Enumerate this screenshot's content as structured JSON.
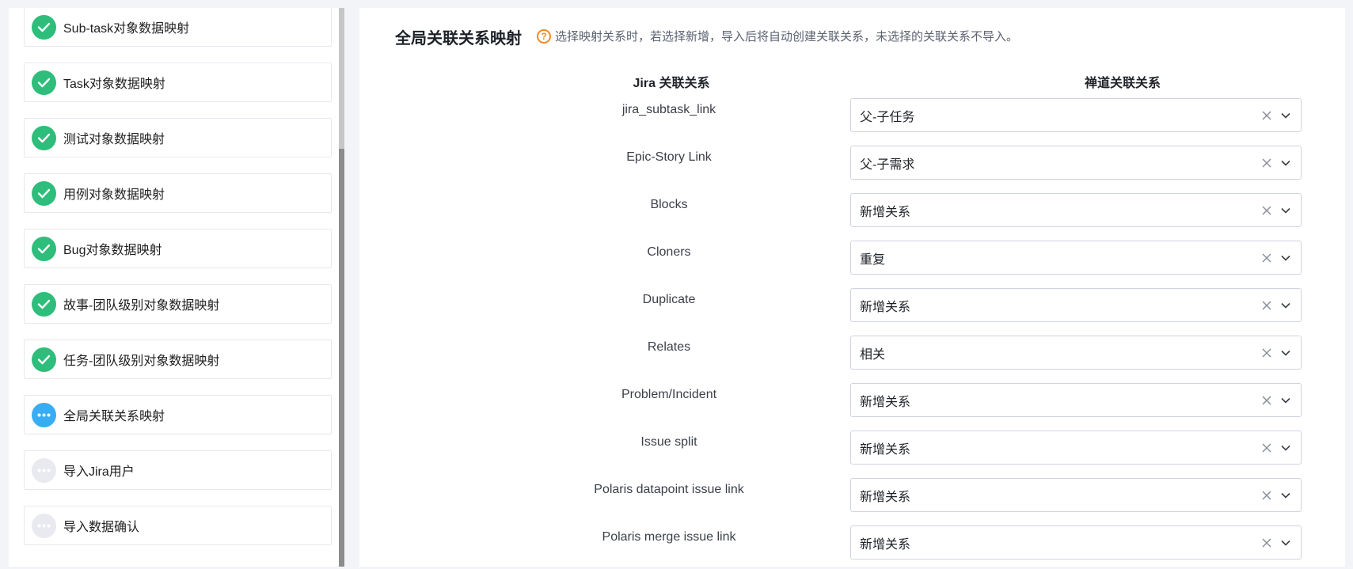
{
  "steps": [
    {
      "label": "Sub-task对象数据映射",
      "status": "done"
    },
    {
      "label": "Task对象数据映射",
      "status": "done"
    },
    {
      "label": "测试对象数据映射",
      "status": "done"
    },
    {
      "label": "用例对象数据映射",
      "status": "done"
    },
    {
      "label": "Bug对象数据映射",
      "status": "done"
    },
    {
      "label": "故事-团队级别对象数据映射",
      "status": "done"
    },
    {
      "label": "任务-团队级别对象数据映射",
      "status": "done"
    },
    {
      "label": "全局关联关系映射",
      "status": "active"
    },
    {
      "label": "导入Jira用户",
      "status": "pending"
    },
    {
      "label": "导入数据确认",
      "status": "pending"
    }
  ],
  "main": {
    "title": "全局关联关系映射",
    "hint_icon": "question-circle-icon",
    "hint": "选择映射关系时，若选择新增，导入后将自动创建关联关系，未选择的关联关系不导入。",
    "col_jira": "Jira 关联关系",
    "col_zentao": "禅道关联关系",
    "rows": [
      {
        "jira": "jira_subtask_link",
        "zentao": "父-子任务"
      },
      {
        "jira": "Epic-Story Link",
        "zentao": "父-子需求"
      },
      {
        "jira": "Blocks",
        "zentao": "新增关系"
      },
      {
        "jira": "Cloners",
        "zentao": "重复"
      },
      {
        "jira": "Duplicate",
        "zentao": "新增关系"
      },
      {
        "jira": "Relates",
        "zentao": "相关"
      },
      {
        "jira": "Problem/Incident",
        "zentao": "新增关系"
      },
      {
        "jira": "Issue split",
        "zentao": "新增关系"
      },
      {
        "jira": "Polaris datapoint issue link",
        "zentao": "新增关系"
      },
      {
        "jira": "Polaris merge issue link",
        "zentao": "新增关系"
      }
    ]
  },
  "colors": {
    "done": "#2ebd7a",
    "active": "#38adf3",
    "pending": "#e9eaf0",
    "hint": "#f08a24"
  }
}
